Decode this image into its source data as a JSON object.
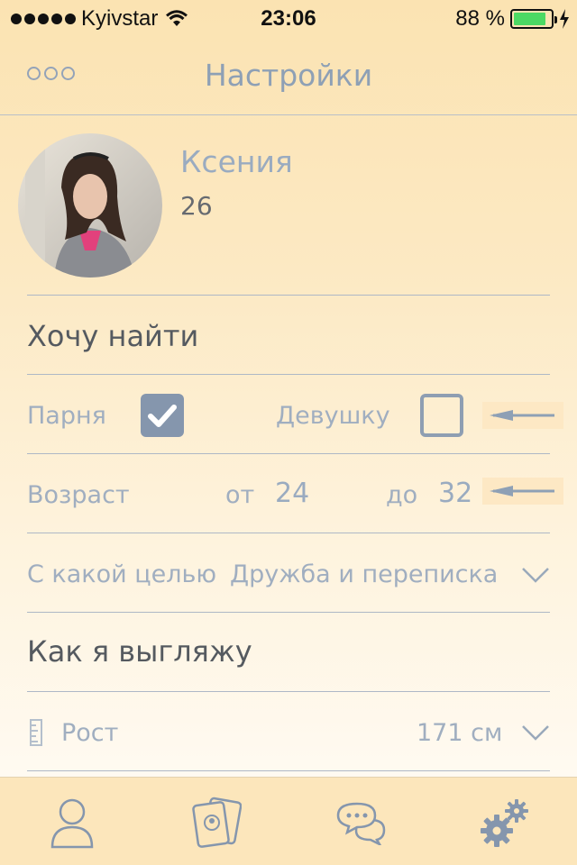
{
  "status_bar": {
    "carrier": "Kyivstar",
    "time": "23:06",
    "battery": "88 %",
    "battery_level": 0.88
  },
  "nav": {
    "title": "Настройки",
    "more_icon": "more-dots-icon"
  },
  "profile": {
    "name": "Ксения",
    "age": "26"
  },
  "seeking": {
    "title": "Хочу найти",
    "male_label": "Парня",
    "male_checked": true,
    "female_label": "Девушку",
    "female_checked": false
  },
  "age_range": {
    "label": "Возраст",
    "from_label": "от",
    "from_value": "24",
    "to_label": "до",
    "to_value": "32"
  },
  "purpose": {
    "label": "С какой целью",
    "value": "Дружба и переписка"
  },
  "appearance": {
    "title": "Как я выгляжу",
    "height_label": "Рост",
    "height_value": "171 см"
  },
  "tabs": [
    {
      "icon": "profile-icon"
    },
    {
      "icon": "cards-icon"
    },
    {
      "icon": "chat-icon"
    },
    {
      "icon": "settings-gears-icon"
    }
  ],
  "colors": {
    "accent": "#8596ad",
    "battery": "#4cd964",
    "tab_bar": "#fce6bb"
  }
}
